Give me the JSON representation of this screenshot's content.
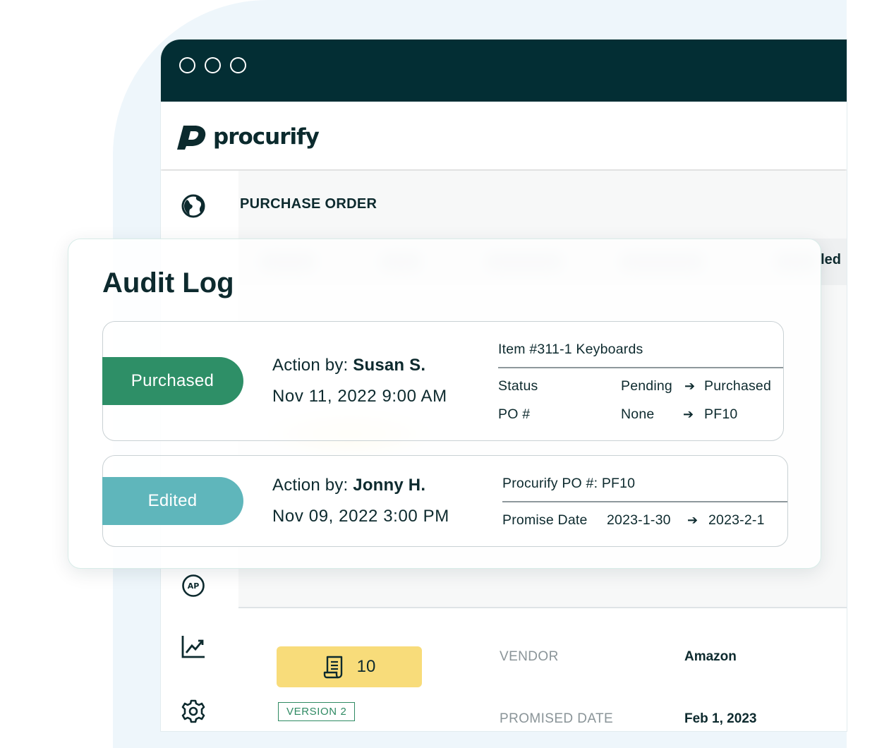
{
  "brand": {
    "name": "procurify",
    "titlebar_color": "#032e34",
    "backdrop_color": "#eef6fb"
  },
  "page": {
    "section_title": "PURCHASE ORDER",
    "truncated_header": "led"
  },
  "sidebar": {
    "icons": [
      "globe-icon",
      "ap-icon",
      "analytics-icon",
      "settings-icon"
    ]
  },
  "audit_log": {
    "title": "Audit Log",
    "entries": [
      {
        "action": "Purchased",
        "color": "#2e8f67",
        "action_by_prefix": "Action by: ",
        "actor": "Susan S.",
        "timestamp": "Nov 11, 2022 9:00 AM",
        "detail_header": "Item #311-1 Keyboards",
        "changes": [
          {
            "field": "Status",
            "from": "Pending",
            "to": "Purchased"
          },
          {
            "field": "PO #",
            "from": "None",
            "to": "PF10"
          }
        ]
      },
      {
        "action": "Edited",
        "color": "#5fb6bb",
        "action_by_prefix": "Action by: ",
        "actor": "Jonny H.",
        "timestamp": "Nov 09, 2022 3:00 PM",
        "detail_header": "Procurify PO #: PF10",
        "changes": [
          {
            "field": "Promise Date",
            "from": "2023-1-30",
            "to": "2023-2-1"
          }
        ]
      }
    ]
  },
  "po_summary": {
    "po_number": "10",
    "version": "VERSION 2",
    "fields": [
      {
        "label": "VENDOR",
        "value": "Amazon"
      },
      {
        "label": "PROMISED DATE",
        "value": "Feb 1, 2023"
      }
    ]
  }
}
